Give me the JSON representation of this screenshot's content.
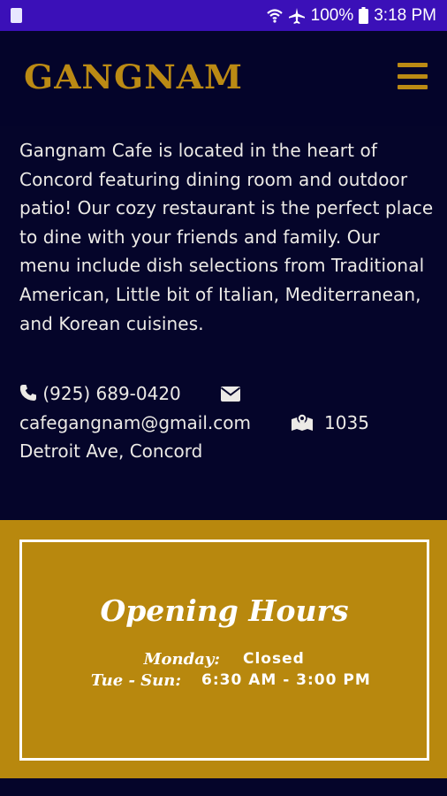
{
  "status_bar": {
    "battery_percent": "100%",
    "time": "3:18 PM",
    "icons": [
      "notification-icon",
      "wifi-icon",
      "airplane-mode-icon",
      "battery-icon"
    ]
  },
  "header": {
    "logo_text": "GANGNAM",
    "menu_icon": "hamburger-menu-icon"
  },
  "about": {
    "text": "Gangnam Cafe is located in the heart of Concord featuring dining room and outdoor patio! Our cozy restaurant is the perfect place to dine with your friends and family. Our menu include dish selections from Traditional American, Little bit of Italian, Mediterranean, and Korean cuisines."
  },
  "contact": {
    "phone": "(925) 689-0420",
    "email": "cafegangnam@gmail.com",
    "address_line1": "1035",
    "address_line2": "Detroit Ave, Concord",
    "icons": [
      "phone-icon",
      "envelope-icon",
      "map-marker-icon"
    ]
  },
  "hours": {
    "title": "Opening Hours",
    "rows": [
      {
        "day": "Monday:",
        "time": "Closed"
      },
      {
        "day": "Tue - Sun:",
        "time": "6:30 AM - 3:00 PM"
      }
    ]
  },
  "colors": {
    "status_bar": "#3b10b8",
    "page_background": "#05052a",
    "gold": "#bb8a14",
    "hours_background": "#b8880e",
    "text_light": "#eceae6"
  }
}
